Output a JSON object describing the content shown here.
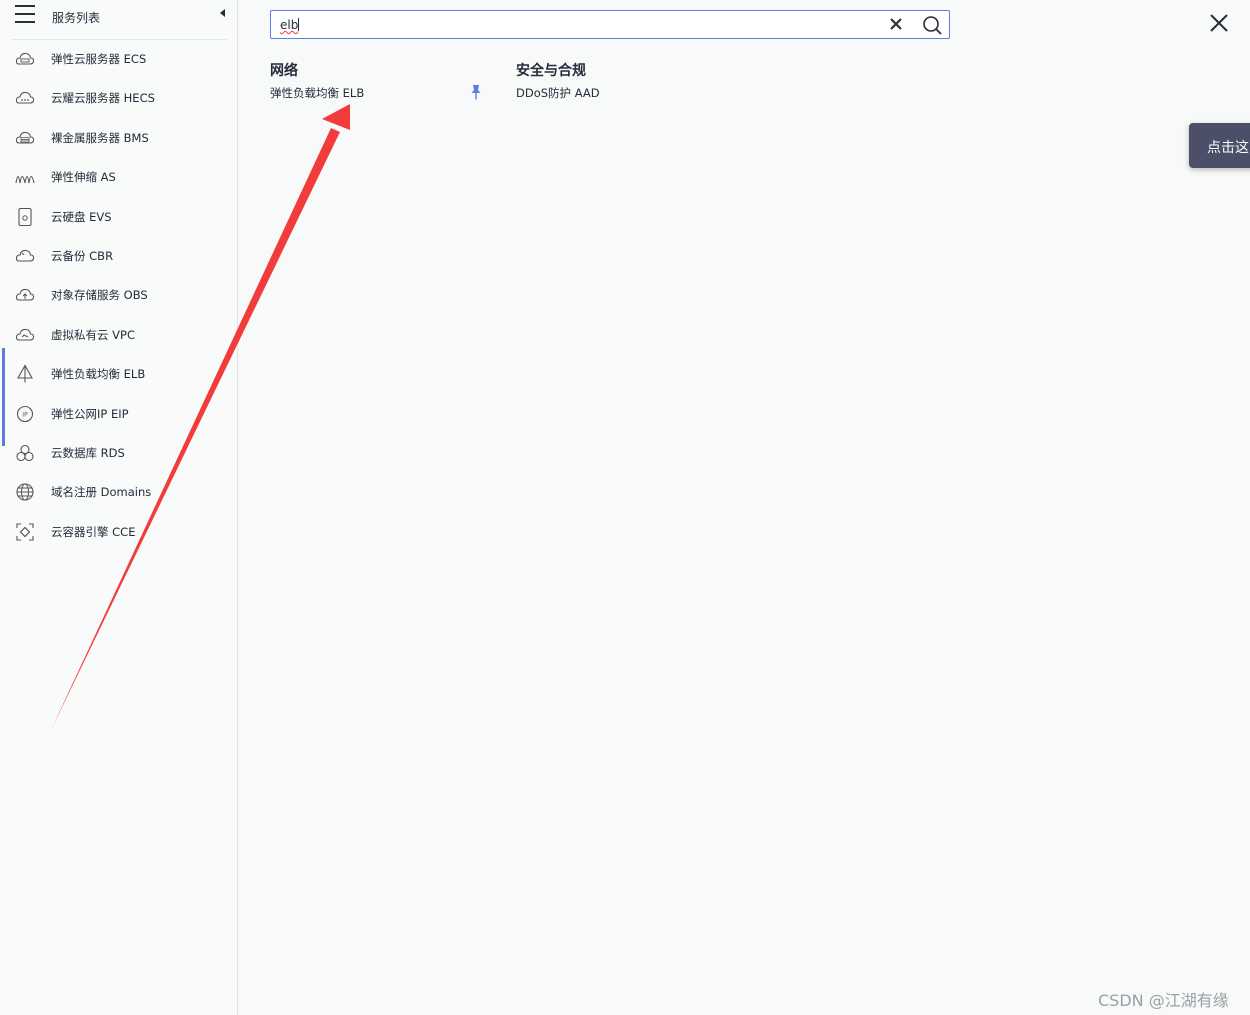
{
  "sidebar": {
    "title": "服务列表",
    "items": [
      {
        "label": "弹性云服务器 ECS",
        "icon": "cloud-server-icon"
      },
      {
        "label": "云耀云服务器 HECS",
        "icon": "cloud-icon"
      },
      {
        "label": "裸金属服务器 BMS",
        "icon": "cloud-server-icon"
      },
      {
        "label": "弹性伸缩 AS",
        "icon": "auto-scaling-icon"
      },
      {
        "label": "云硬盘 EVS",
        "icon": "disk-icon"
      },
      {
        "label": "云备份 CBR",
        "icon": "backup-cloud-icon"
      },
      {
        "label": "对象存储服务 OBS",
        "icon": "upload-cloud-icon"
      },
      {
        "label": "虚拟私有云 VPC",
        "icon": "vpc-cloud-icon"
      },
      {
        "label": "弹性负载均衡 ELB",
        "icon": "load-balancer-icon"
      },
      {
        "label": "弹性公网IP EIP",
        "icon": "ip-icon"
      },
      {
        "label": "云数据库 RDS",
        "icon": "database-icon"
      },
      {
        "label": "域名注册 Domains",
        "icon": "globe-icon"
      },
      {
        "label": "云容器引擎 CCE",
        "icon": "container-icon"
      }
    ]
  },
  "search": {
    "value": "elb"
  },
  "results": [
    {
      "title": "网络",
      "items": [
        "弹性负载均衡 ELB"
      ]
    },
    {
      "title": "安全与合规",
      "items": [
        "DDoS防护 AAD"
      ]
    }
  ],
  "tooltip": "点击这",
  "watermark": "CSDN @江湖有缘",
  "colors": {
    "accent": "#5e7ce0",
    "arrow": "#f23c3c",
    "tooltip_bg": "#4b5068"
  }
}
